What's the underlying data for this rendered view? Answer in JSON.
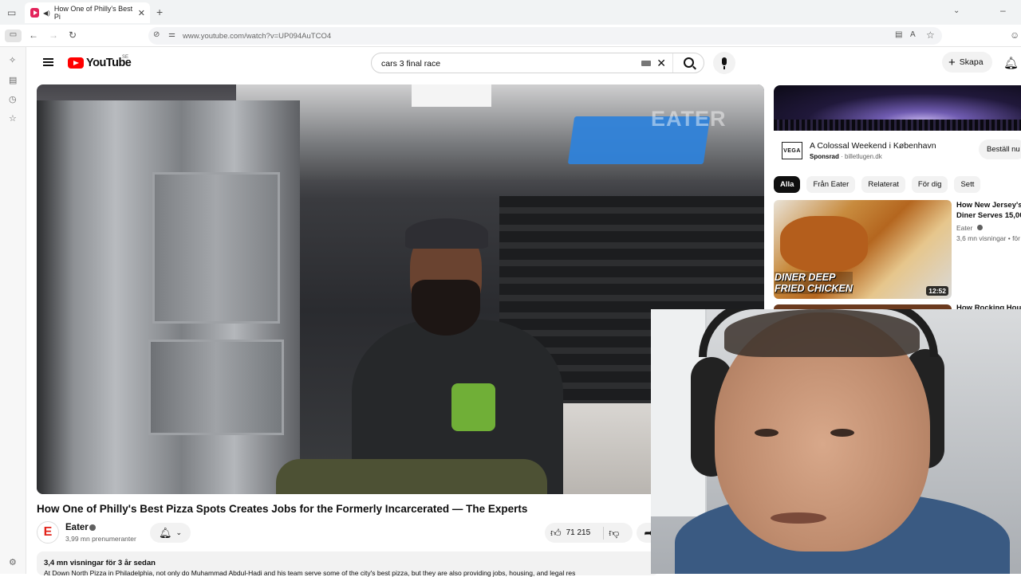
{
  "browser": {
    "tab_title": "How One of Philly's Best Pi",
    "tab_close": "✕",
    "new_tab": "+",
    "url": "www.youtube.com/watch?v=UP094AuTCO4"
  },
  "youtube": {
    "logo_text": "YouTube",
    "country_code": "SE",
    "search_value": "cars 3 final race",
    "create_label": "Skapa"
  },
  "video": {
    "title": "How One of Philly's Best Pizza Spots Creates Jobs for the Formerly Incarcerated — The Experts",
    "watermark": "EATER",
    "channel_name": "Eater",
    "channel_initial": "E",
    "subscribers": "3,99 mn prenumeranter",
    "likes": "71 215",
    "views_age": "3,4 mn visningar  för 3 år sedan",
    "description": "At Down North Pizza in Philadelphia, not only do Muhammad Abdul-Hadi and his team serve some of the city's best pizza, but they are also providing jobs, housing, and legal res"
  },
  "sidebar_right": {
    "ad": {
      "logo": "VEGA",
      "title": "A Colossal Weekend i København",
      "sponsor_label": "Sponsrad",
      "sponsor_site": "billetlugen.dk",
      "cta": "Beställ nu"
    },
    "chips": [
      "Alla",
      "Från Eater",
      "Relaterat",
      "För dig",
      "Sett"
    ],
    "recommendations": [
      {
        "title_line1": "How New Jersey's",
        "title_line2": "Diner Serves 15,00",
        "channel": "Eater",
        "meta": "3,6 mn visningar • för",
        "overlay_line1": "DINER DEEP",
        "overlay_line2": "FRIED CHICKEN",
        "duration": "12:52"
      },
      {
        "title_line1": "How Rocking Hous"
      }
    ]
  }
}
